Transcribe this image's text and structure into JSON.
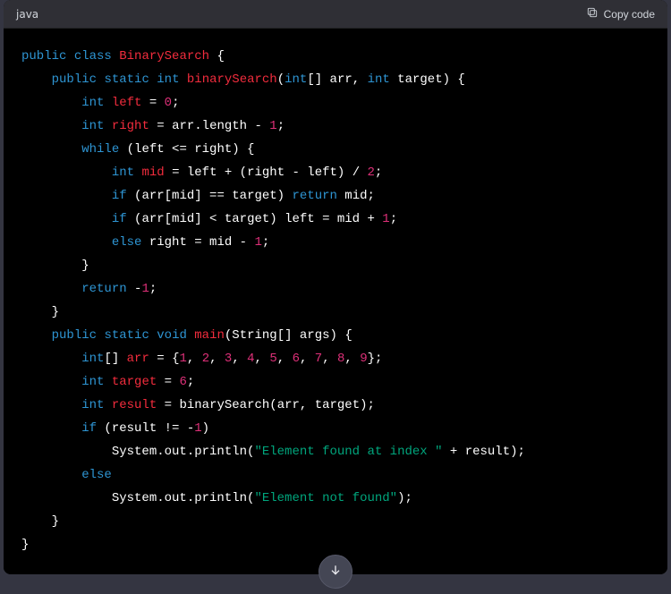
{
  "header": {
    "language": "java",
    "copy_label": "Copy code"
  },
  "code": {
    "tokens": [
      [
        [
          "kw",
          "public"
        ],
        [
          "pln",
          " "
        ],
        [
          "kw",
          "class"
        ],
        [
          "pln",
          " "
        ],
        [
          "name",
          "BinarySearch"
        ],
        [
          "pln",
          " {"
        ]
      ],
      [
        [
          "pln",
          "    "
        ],
        [
          "kw",
          "public"
        ],
        [
          "pln",
          " "
        ],
        [
          "kw",
          "static"
        ],
        [
          "pln",
          " "
        ],
        [
          "type",
          "int"
        ],
        [
          "pln",
          " "
        ],
        [
          "name",
          "binarySearch"
        ],
        [
          "pln",
          "("
        ],
        [
          "type",
          "int"
        ],
        [
          "pln",
          "[] arr, "
        ],
        [
          "type",
          "int"
        ],
        [
          "pln",
          " target) {"
        ]
      ],
      [
        [
          "pln",
          "        "
        ],
        [
          "type",
          "int"
        ],
        [
          "pln",
          " "
        ],
        [
          "name",
          "left"
        ],
        [
          "pln",
          " = "
        ],
        [
          "num",
          "0"
        ],
        [
          "pln",
          ";"
        ]
      ],
      [
        [
          "pln",
          "        "
        ],
        [
          "type",
          "int"
        ],
        [
          "pln",
          " "
        ],
        [
          "name",
          "right"
        ],
        [
          "pln",
          " = arr.length - "
        ],
        [
          "num",
          "1"
        ],
        [
          "pln",
          ";"
        ]
      ],
      [
        [
          "pln",
          "        "
        ],
        [
          "kw",
          "while"
        ],
        [
          "pln",
          " (left <= right) {"
        ]
      ],
      [
        [
          "pln",
          "            "
        ],
        [
          "type",
          "int"
        ],
        [
          "pln",
          " "
        ],
        [
          "name",
          "mid"
        ],
        [
          "pln",
          " = left + (right - left) / "
        ],
        [
          "num",
          "2"
        ],
        [
          "pln",
          ";"
        ]
      ],
      [
        [
          "pln",
          "            "
        ],
        [
          "kw",
          "if"
        ],
        [
          "pln",
          " (arr[mid] == target) "
        ],
        [
          "kw",
          "return"
        ],
        [
          "pln",
          " mid;"
        ]
      ],
      [
        [
          "pln",
          "            "
        ],
        [
          "kw",
          "if"
        ],
        [
          "pln",
          " (arr[mid] < target) left = mid + "
        ],
        [
          "num",
          "1"
        ],
        [
          "pln",
          ";"
        ]
      ],
      [
        [
          "pln",
          "            "
        ],
        [
          "kw",
          "else"
        ],
        [
          "pln",
          " right = mid - "
        ],
        [
          "num",
          "1"
        ],
        [
          "pln",
          ";"
        ]
      ],
      [
        [
          "pln",
          "        }"
        ]
      ],
      [
        [
          "pln",
          "        "
        ],
        [
          "kw",
          "return"
        ],
        [
          "pln",
          " -"
        ],
        [
          "num",
          "1"
        ],
        [
          "pln",
          ";"
        ]
      ],
      [
        [
          "pln",
          "    }"
        ]
      ],
      [
        [
          "pln",
          "    "
        ],
        [
          "kw",
          "public"
        ],
        [
          "pln",
          " "
        ],
        [
          "kw",
          "static"
        ],
        [
          "pln",
          " "
        ],
        [
          "kw",
          "void"
        ],
        [
          "pln",
          " "
        ],
        [
          "name",
          "main"
        ],
        [
          "pln",
          "(String[] args) {"
        ]
      ],
      [
        [
          "pln",
          "        "
        ],
        [
          "type",
          "int"
        ],
        [
          "pln",
          "[] "
        ],
        [
          "name",
          "arr"
        ],
        [
          "pln",
          " = {"
        ],
        [
          "num",
          "1"
        ],
        [
          "pln",
          ", "
        ],
        [
          "num",
          "2"
        ],
        [
          "pln",
          ", "
        ],
        [
          "num",
          "3"
        ],
        [
          "pln",
          ", "
        ],
        [
          "num",
          "4"
        ],
        [
          "pln",
          ", "
        ],
        [
          "num",
          "5"
        ],
        [
          "pln",
          ", "
        ],
        [
          "num",
          "6"
        ],
        [
          "pln",
          ", "
        ],
        [
          "num",
          "7"
        ],
        [
          "pln",
          ", "
        ],
        [
          "num",
          "8"
        ],
        [
          "pln",
          ", "
        ],
        [
          "num",
          "9"
        ],
        [
          "pln",
          "};"
        ]
      ],
      [
        [
          "pln",
          "        "
        ],
        [
          "type",
          "int"
        ],
        [
          "pln",
          " "
        ],
        [
          "name",
          "target"
        ],
        [
          "pln",
          " = "
        ],
        [
          "num",
          "6"
        ],
        [
          "pln",
          ";"
        ]
      ],
      [
        [
          "pln",
          "        "
        ],
        [
          "type",
          "int"
        ],
        [
          "pln",
          " "
        ],
        [
          "name",
          "result"
        ],
        [
          "pln",
          " = binarySearch(arr, target);"
        ]
      ],
      [
        [
          "pln",
          "        "
        ],
        [
          "kw",
          "if"
        ],
        [
          "pln",
          " (result != -"
        ],
        [
          "num",
          "1"
        ],
        [
          "pln",
          ")"
        ]
      ],
      [
        [
          "pln",
          "            System.out.println("
        ],
        [
          "str",
          "\"Element found at index \""
        ],
        [
          "pln",
          " + result);"
        ]
      ],
      [
        [
          "pln",
          "        "
        ],
        [
          "kw",
          "else"
        ]
      ],
      [
        [
          "pln",
          "            System.out.println("
        ],
        [
          "str",
          "\"Element not found\""
        ],
        [
          "pln",
          ");"
        ]
      ],
      [
        [
          "pln",
          "    }"
        ]
      ],
      [
        [
          "pln",
          "}"
        ]
      ]
    ]
  }
}
